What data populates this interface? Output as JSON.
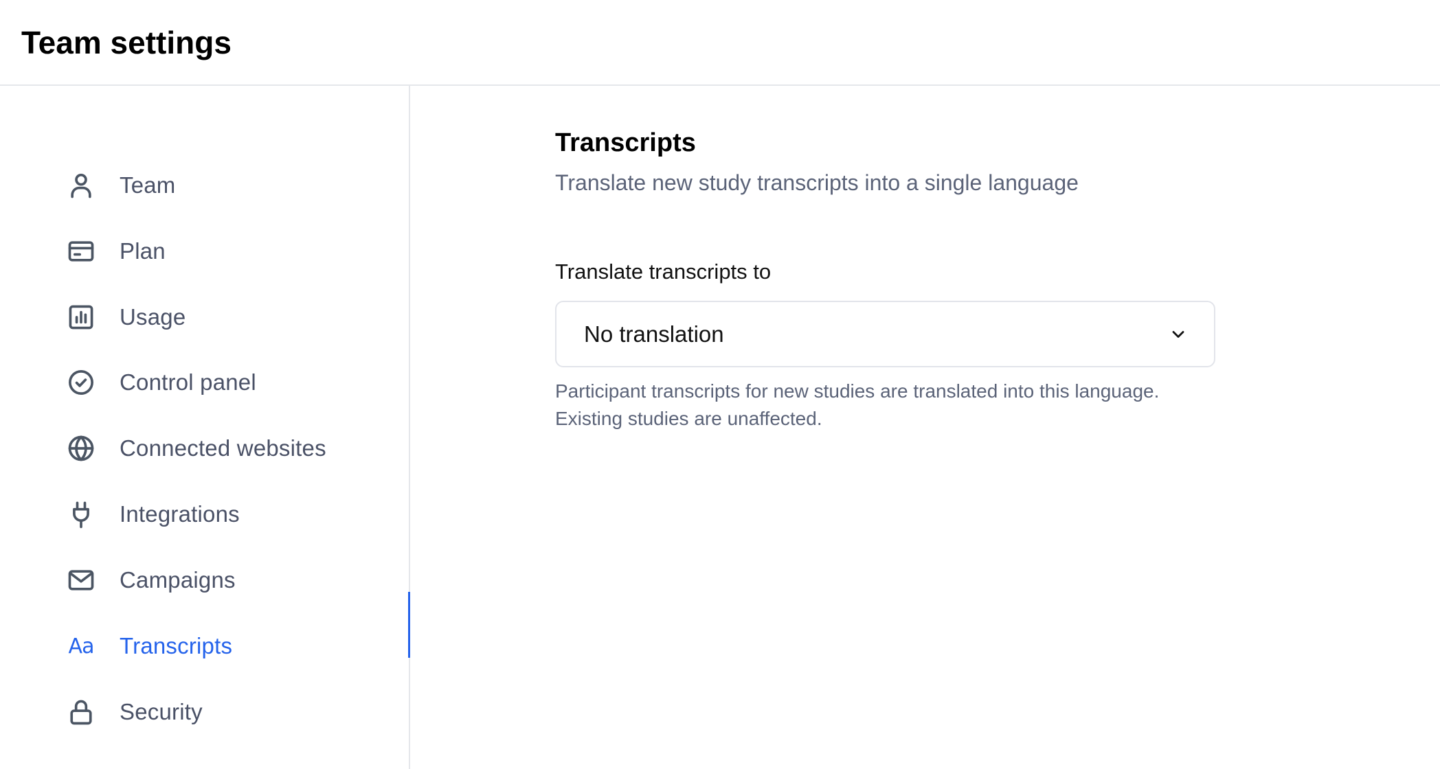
{
  "header": {
    "title": "Team settings"
  },
  "sidebar": {
    "items": [
      {
        "label": "Team",
        "icon": "user-icon"
      },
      {
        "label": "Plan",
        "icon": "credit-card-icon"
      },
      {
        "label": "Usage",
        "icon": "bar-chart-icon"
      },
      {
        "label": "Control panel",
        "icon": "check-circle-icon"
      },
      {
        "label": "Connected websites",
        "icon": "globe-icon"
      },
      {
        "label": "Integrations",
        "icon": "plug-icon"
      },
      {
        "label": "Campaigns",
        "icon": "mail-icon"
      },
      {
        "label": "Transcripts",
        "icon": "text-aa-icon",
        "icon_text": "Aa",
        "active": true
      },
      {
        "label": "Security",
        "icon": "lock-icon"
      }
    ],
    "active_color": "#2563eb"
  },
  "main": {
    "section_title": "Transcripts",
    "section_subtitle": "Translate new study transcripts into a single language",
    "field_label": "Translate transcripts to",
    "select": {
      "value": "No translation",
      "icon": "chevron-down-icon"
    },
    "help_line_1": "Participant transcripts for new studies are translated into this language.",
    "help_line_2": "Existing studies are unaffected."
  }
}
